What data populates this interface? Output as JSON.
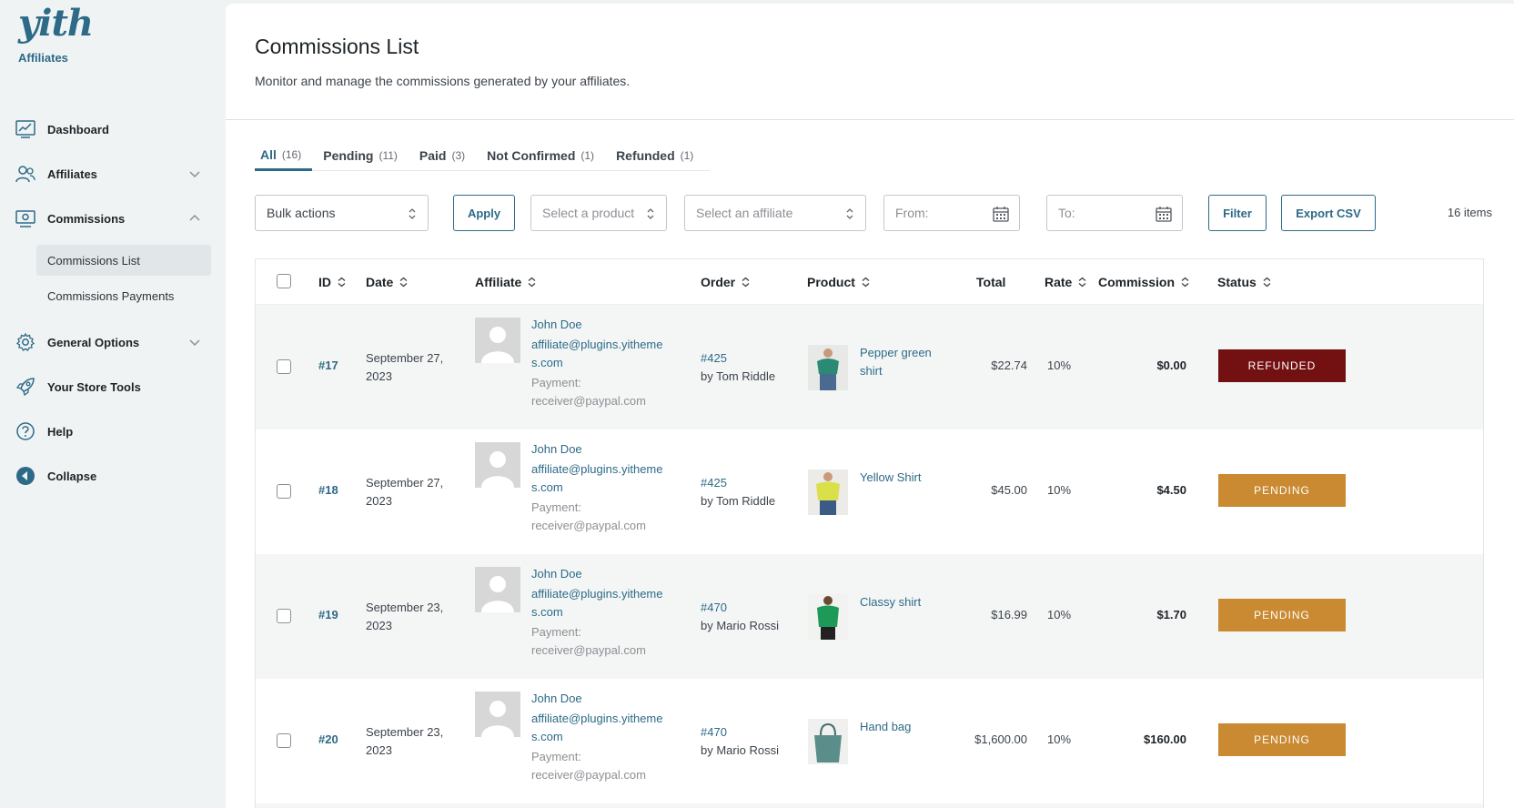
{
  "brand": {
    "logo": "yith",
    "subtitle": "Affiliates",
    "color": "#2d6a87"
  },
  "sidebar": {
    "items": [
      {
        "label": "Dashboard",
        "icon": "chart-icon"
      },
      {
        "label": "Affiliates",
        "icon": "users-icon",
        "expandable": true
      },
      {
        "label": "Commissions",
        "icon": "money-icon",
        "expanded": true
      },
      {
        "label": "General Options",
        "icon": "gear-icon",
        "expandable": true
      },
      {
        "label": "Your Store Tools",
        "icon": "rocket-icon"
      },
      {
        "label": "Help",
        "icon": "help-icon"
      },
      {
        "label": "Collapse",
        "icon": "collapse-icon"
      }
    ],
    "subitems": [
      {
        "label": "Commissions List",
        "active": true
      },
      {
        "label": "Commissions Payments"
      }
    ]
  },
  "header": {
    "title": "Commissions List",
    "description": "Monitor and manage the commissions generated by your affiliates."
  },
  "tabs": [
    {
      "label": "All",
      "count": "(16)",
      "active": true
    },
    {
      "label": "Pending",
      "count": "(11)"
    },
    {
      "label": "Paid",
      "count": "(3)"
    },
    {
      "label": "Not Confirmed",
      "count": "(1)"
    },
    {
      "label": "Refunded",
      "count": "(1)"
    }
  ],
  "filters": {
    "bulk_actions": "Bulk actions",
    "apply": "Apply",
    "product_placeholder": "Select a product",
    "affiliate_placeholder": "Select an affiliate",
    "from_placeholder": "From:",
    "to_placeholder": "To:",
    "filter": "Filter",
    "export": "Export CSV",
    "items_count": "16 items"
  },
  "table": {
    "columns": {
      "id": "ID",
      "date": "Date",
      "affiliate": "Affiliate",
      "order": "Order",
      "product": "Product",
      "total": "Total",
      "rate": "Rate",
      "commission": "Commission",
      "status": "Status"
    },
    "rows": [
      {
        "id": "#17",
        "date": "September 27, 2023",
        "aff_name": "John Doe",
        "aff_email": "affiliate@plugins.yithemes.com",
        "aff_payment": "Payment: receiver@paypal.com",
        "order": "#425",
        "order_by": "by Tom Riddle",
        "product": "Pepper green shirt",
        "total": "$22.74",
        "rate": "10%",
        "commission": "$0.00",
        "status": "REFUNDED",
        "status_color": "#731112"
      },
      {
        "id": "#18",
        "date": "September 27, 2023",
        "aff_name": "John Doe",
        "aff_email": "affiliate@plugins.yithemes.com",
        "aff_payment": "Payment: receiver@paypal.com",
        "order": "#425",
        "order_by": "by Tom Riddle",
        "product": "Yellow Shirt",
        "total": "$45.00",
        "rate": "10%",
        "commission": "$4.50",
        "status": "PENDING",
        "status_color": "#c98a32"
      },
      {
        "id": "#19",
        "date": "September 23, 2023",
        "aff_name": "John Doe",
        "aff_email": "affiliate@plugins.yithemes.com",
        "aff_payment": "Payment: receiver@paypal.com",
        "order": "#470",
        "order_by": "by Mario Rossi",
        "product": "Classy shirt",
        "total": "$16.99",
        "rate": "10%",
        "commission": "$1.70",
        "status": "PENDING",
        "status_color": "#c98a32"
      },
      {
        "id": "#20",
        "date": "September 23, 2023",
        "aff_name": "John Doe",
        "aff_email": "affiliate@plugins.yithemes.com",
        "aff_payment": "Payment: receiver@paypal.com",
        "order": "#470",
        "order_by": "by Mario Rossi",
        "product": "Hand bag",
        "total": "$1,600.00",
        "rate": "10%",
        "commission": "$160.00",
        "status": "PENDING",
        "status_color": "#c98a32"
      }
    ]
  }
}
